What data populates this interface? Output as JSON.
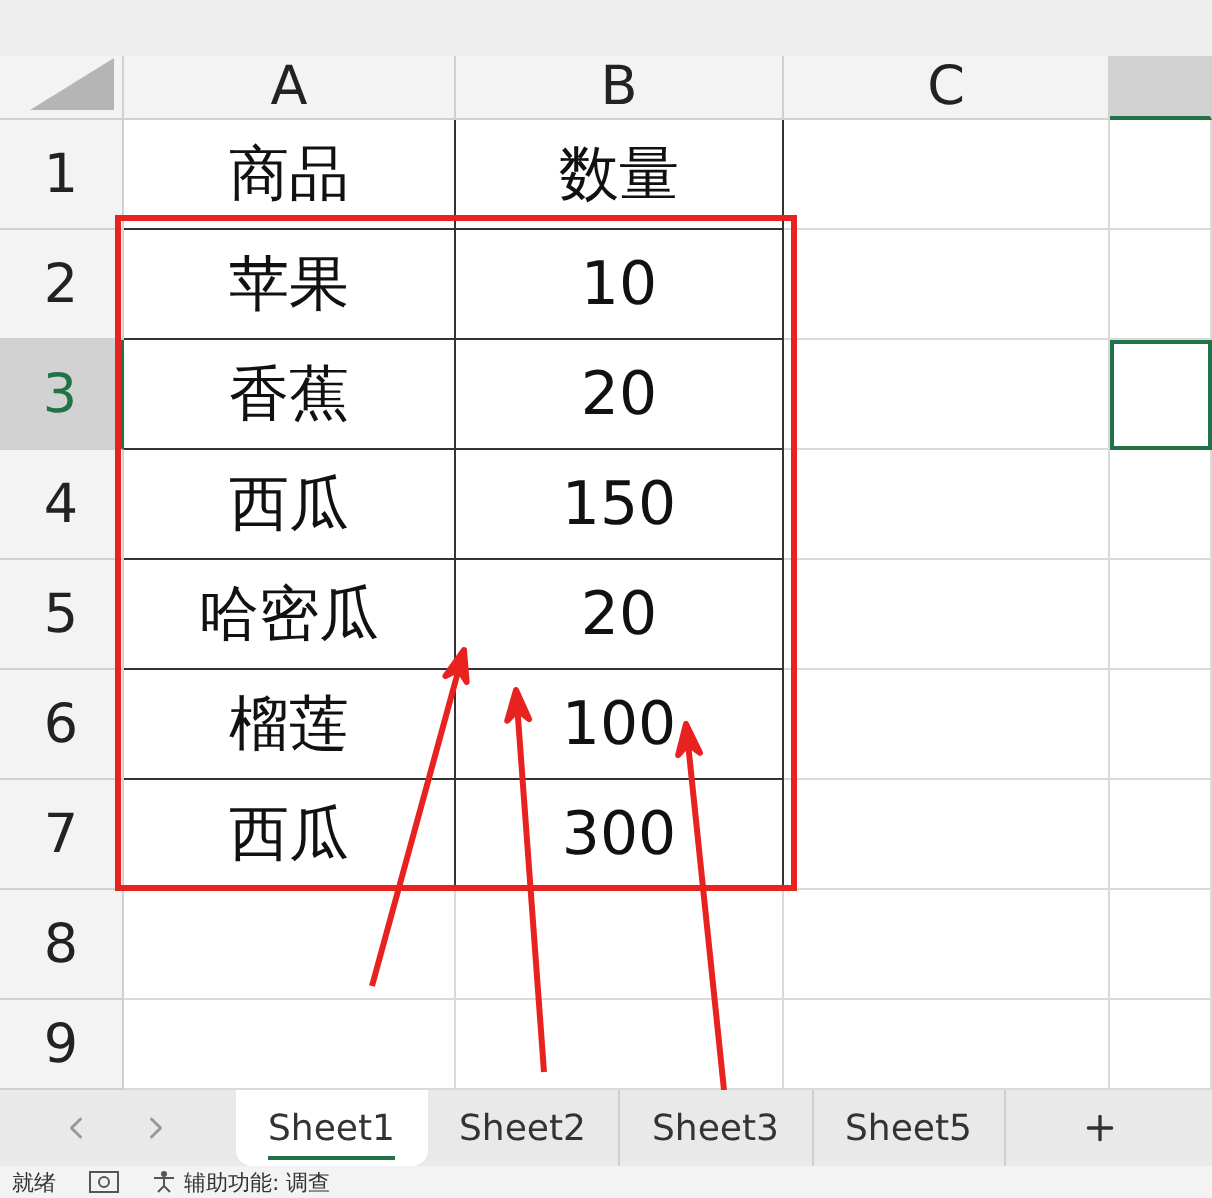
{
  "columns": [
    {
      "label": "A",
      "selected": false
    },
    {
      "label": "B",
      "selected": false
    },
    {
      "label": "C",
      "selected": false
    }
  ],
  "rows": [
    {
      "label": "1",
      "selected": false,
      "cells": [
        "商品",
        "数量"
      ]
    },
    {
      "label": "2",
      "selected": false,
      "cells": [
        "苹果",
        "10"
      ]
    },
    {
      "label": "3",
      "selected": true,
      "cells": [
        "香蕉",
        "20"
      ]
    },
    {
      "label": "4",
      "selected": false,
      "cells": [
        "西瓜",
        "150"
      ]
    },
    {
      "label": "5",
      "selected": false,
      "cells": [
        "哈密瓜",
        "20"
      ]
    },
    {
      "label": "6",
      "selected": false,
      "cells": [
        "榴莲",
        "100"
      ]
    },
    {
      "label": "7",
      "selected": false,
      "cells": [
        "西瓜",
        "300"
      ]
    },
    {
      "label": "8",
      "selected": false,
      "cells": []
    },
    {
      "label": "9",
      "selected": false,
      "cells": []
    }
  ],
  "sheet_tabs": [
    {
      "label": "Sheet1",
      "selected": true
    },
    {
      "label": "Sheet2",
      "selected": false
    },
    {
      "label": "Sheet3",
      "selected": false
    },
    {
      "label": "Sheet5",
      "selected": false
    }
  ],
  "status_bar": {
    "state": "就绪",
    "accessibility": "辅助功能: 调查"
  }
}
